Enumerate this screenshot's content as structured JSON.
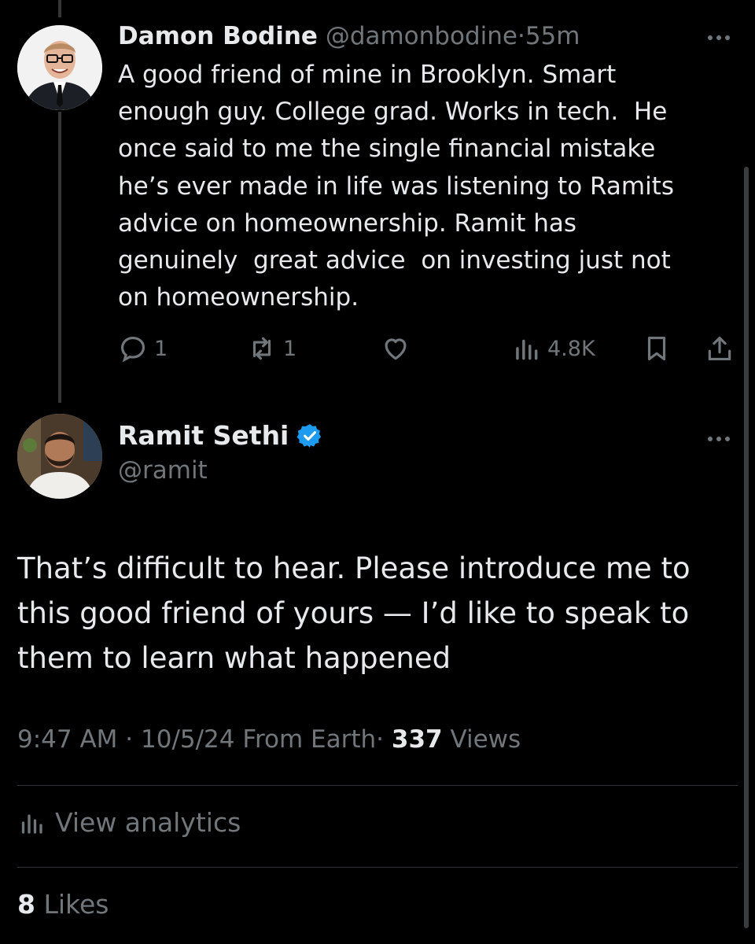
{
  "parent_tweet": {
    "display_name": "Damon Bodine",
    "handle": "@damonbodine",
    "separator": "·",
    "time": "55m",
    "text": "A good friend of mine in Brooklyn. Smart\nenough guy. College grad. Works in tech.  He\nonce said to me the single financial mistake\nhe’s ever made in life was listening to Ramits\nadvice on homeownership. Ramit has\ngenuinely  great advice  on investing just not\non homeownership.",
    "replies": "1",
    "reposts": "1",
    "views": "4.8K",
    "avatar_icon": "person-glasses-suit-avatar"
  },
  "reply_tweet": {
    "display_name": "Ramit Sethi",
    "handle": "@ramit",
    "verified_icon": "verified-badge-icon",
    "text": "That’s difficult to hear. Please introduce me to\nthis good friend of yours — I’d like to speak to\nthem to learn what happened",
    "time": "9:47 AM",
    "date": "10/5/24",
    "source": "From Earth",
    "views_count": "337",
    "views_label": "Views",
    "separator": "·",
    "avatar_icon": "person-beard-avatar"
  },
  "analytics": {
    "label": "View analytics"
  },
  "likes": {
    "count": "8",
    "label": "Likes"
  },
  "colors": {
    "background": "#000000",
    "text": "#e7e9ea",
    "muted": "#71767b",
    "accent": "#1d9bf0"
  }
}
